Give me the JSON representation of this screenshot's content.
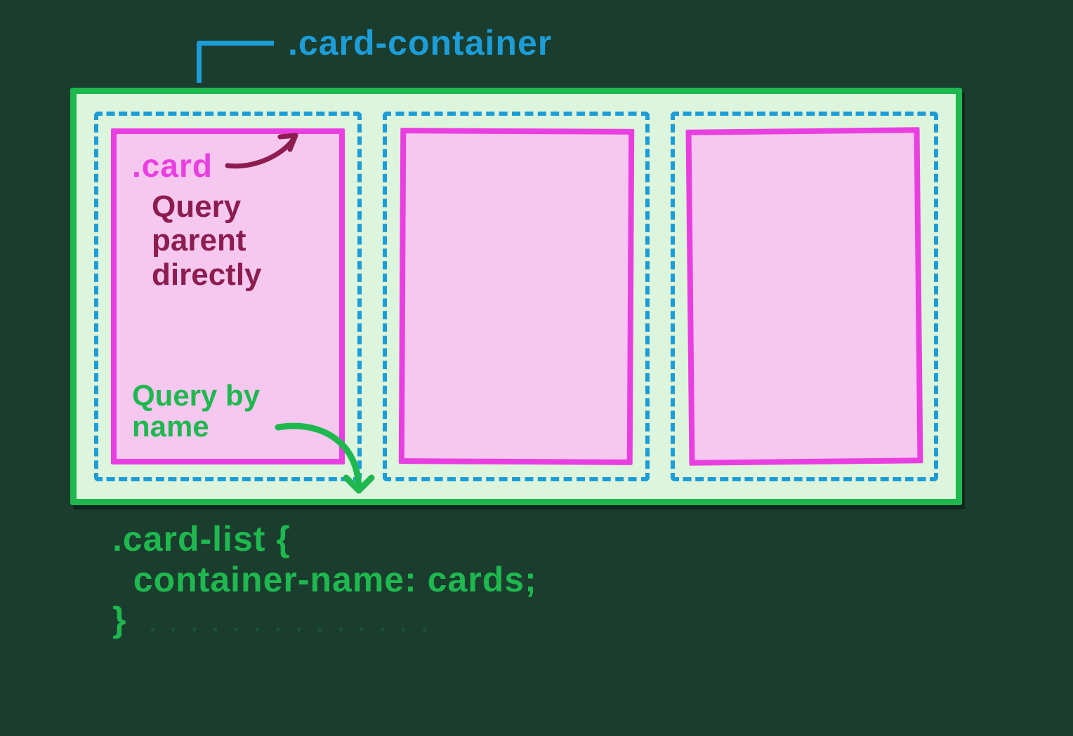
{
  "colors": {
    "green": "#1eb84f",
    "green_bg": "#dcf5dc",
    "blue": "#1c9dd8",
    "magenta": "#e93fe0",
    "pink_bg": "#f6c8f0",
    "maroon": "#8d1d4f"
  },
  "annotations": {
    "card_container_class": ".card-container",
    "card_class": ".card",
    "query_parent_text": "Query\nparent\ndirectly",
    "query_by_name_text": "Query by\nname"
  },
  "code": {
    "selector": ".card-list {",
    "rule": "  container-name: cards;",
    "close": "}"
  },
  "card_count": 3
}
